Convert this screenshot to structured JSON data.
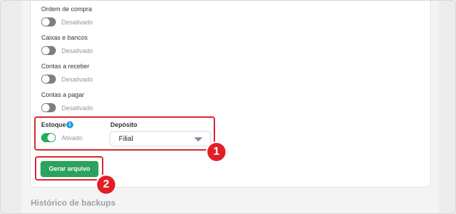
{
  "settings": [
    {
      "label": "Ordem de compra",
      "state": "Desativado"
    },
    {
      "label": "Caixas e bancos",
      "state": "Desativado"
    },
    {
      "label": "Contas a receber",
      "state": "Desativado"
    },
    {
      "label": "Contas a pagar",
      "state": "Desativado"
    }
  ],
  "estoque": {
    "label": "Estoque",
    "info_icon": "i",
    "state": "Ativado",
    "toggle_on": true
  },
  "deposito": {
    "label": "Depósito",
    "selected": "Filial"
  },
  "generate_button": "Gerar arquivo",
  "annotations": {
    "badge_1": "1",
    "badge_2": "2"
  },
  "section_title": "Histórico de backups",
  "colors": {
    "accent_green": "#28a960",
    "annotation_red": "#e11f26",
    "info_blue": "#1e9ed9"
  }
}
